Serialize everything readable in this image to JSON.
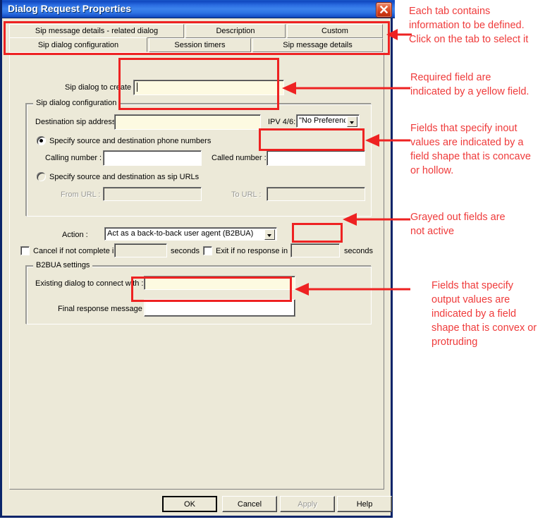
{
  "window": {
    "title": "Dialog Request Properties",
    "close_icon": "close-icon"
  },
  "tabs": {
    "row_top": [
      {
        "label": "Sip message details - related dialog",
        "selected": false
      },
      {
        "label": "Description",
        "selected": false
      },
      {
        "label": "Custom",
        "selected": false
      }
    ],
    "row_bottom": [
      {
        "label": "Sip dialog configuration",
        "selected": true
      },
      {
        "label": "Session timers",
        "selected": false
      },
      {
        "label": "Sip message details",
        "selected": false
      }
    ]
  },
  "form": {
    "sip_dialog_to_create_label": "Sip dialog to create :",
    "sip_dialog_to_create_value": "",
    "group_sip_dialog_configuration": "Sip dialog configuration",
    "destination_sip_address_label": "Destination sip address :",
    "destination_sip_address_value": "",
    "ipv_label": "IPV 4/6:",
    "ipv_value": "\"No Preferenc",
    "radio_phone_numbers": "Specify source and destination phone numbers",
    "calling_number_label": "Calling number :",
    "calling_number_value": "",
    "called_number_label": "Called number :",
    "called_number_value": "",
    "radio_sip_urls": "Specify source and destination as sip URLs",
    "from_url_label": "From URL :",
    "from_url_value": "",
    "to_url_label": "To URL :",
    "to_url_value": "",
    "action_label": "Action :",
    "action_value": "Act as a back-to-back user agent (B2BUA)",
    "cancel_if_not_complete_label": "Cancel if not complete in",
    "cancel_if_not_complete_value": "",
    "cancel_seconds_label": "seconds",
    "exit_if_no_response_label": "Exit if no response in",
    "exit_if_no_response_value": "",
    "exit_seconds_label": "seconds",
    "group_b2bua_settings": "B2BUA settings",
    "existing_dialog_label": "Existing dialog to connect with :",
    "existing_dialog_value": "",
    "final_response_label": "Final response message",
    "final_response_value": ""
  },
  "buttons": {
    "ok": "OK",
    "cancel": "Cancel",
    "apply": "Apply",
    "help": "Help"
  },
  "annotations": [
    {
      "id": "tabs-note",
      "text": "Each tab contains\ninformation to be defined.\nClick on the tab to select it"
    },
    {
      "id": "required-note",
      "text": "Required field are\nindicated by a yellow field."
    },
    {
      "id": "inout-note",
      "text": "Fields that specify inout\nvalues are indicated by a\nfield shape that is concave\nor hollow."
    },
    {
      "id": "grayed-note",
      "text": "Grayed out fields are\nnot active"
    },
    {
      "id": "output-note",
      "text": "Fields that specify\noutput values are\nindicated by a field\nshape that is convex or\nprotruding"
    }
  ],
  "colors": {
    "annotation_red": "#ef3b3b",
    "highlight_box_red": "#ee2222",
    "required_field_yellow": "#fdfae1",
    "dialog_face": "#ece9d8",
    "titlebar_blue": "#0a246a"
  }
}
